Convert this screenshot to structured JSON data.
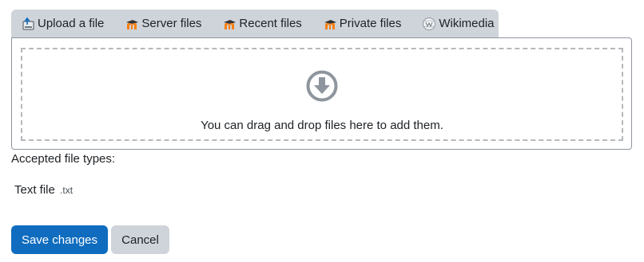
{
  "tabs": [
    {
      "label": "Upload a file",
      "icon": "upload-icon"
    },
    {
      "label": "Server files",
      "icon": "moodle-icon"
    },
    {
      "label": "Recent files",
      "icon": "moodle-icon"
    },
    {
      "label": "Private files",
      "icon": "moodle-icon"
    },
    {
      "label": "Wikimedia",
      "icon": "wikimedia-icon"
    }
  ],
  "dropzone": {
    "message": "You can drag and drop files here to add them.",
    "icon": "download-arrow-icon"
  },
  "accepted": {
    "label": "Accepted file types:",
    "types": [
      {
        "name": "Text file",
        "ext": ".txt"
      }
    ]
  },
  "buttons": {
    "save_label": "Save changes",
    "cancel_label": "Cancel"
  },
  "colors": {
    "primary": "#0f6cbf",
    "secondary": "#ced4da",
    "moodle_orange": "#f98012"
  }
}
